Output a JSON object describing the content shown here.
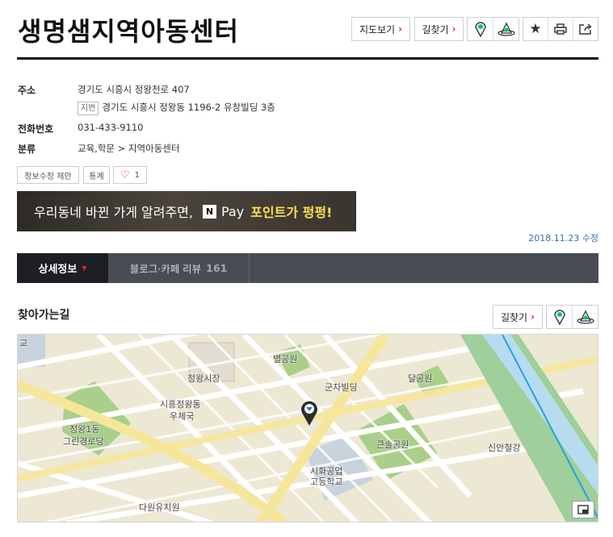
{
  "place": {
    "title": "생명샘지역아동센터",
    "address_label": "주소",
    "address": "경기도 시흥시 정왕천로 407",
    "lot_tag": "지번",
    "lot_address": "경기도 시흥시 정왕동 1196-2 유창빌딩 3층",
    "phone_label": "전화번호",
    "phone": "031-433-9110",
    "category_label": "분류",
    "category": "교육,학문 > 지역아동센터"
  },
  "header_buttons": {
    "map_view": "지도보기",
    "directions": "길찾기"
  },
  "actions": {
    "suggest_edit": "정보수정 제안",
    "stats": "통계",
    "like_count": "1"
  },
  "banner": {
    "text": "우리동네 바뀐 가게 알려주면,",
    "pay_n": "N",
    "pay": "Pay",
    "highlight": "포인트가 펑펑!"
  },
  "updated": "2018.11.23 수정",
  "tabs": {
    "detail": "상세정보",
    "review": "블로그·카페 리뷰",
    "review_count": "161"
  },
  "directions_section": {
    "title": "찾아가는길",
    "directions_button": "길찾기"
  },
  "map_labels": {
    "edge_left": "교",
    "market": "정왕시장",
    "post_office_1": "시흥정왕동",
    "post_office_2": "우체국",
    "star_park": "별공원",
    "gunja": "군자빌딩",
    "moon_park": "달공원",
    "church_1": "정왕1동",
    "church_2": "그린경로당",
    "keunsol": "큰솔공원",
    "school_1": "시화공업",
    "school_2": "고등학교",
    "sinan": "신안철강",
    "kinder": "다원유치원"
  },
  "colors": {
    "accent_red": "#e5252a",
    "tab_dark": "#1e1f24",
    "tab_bar": "#4a4c55",
    "naver_green": "#03c75a",
    "link_blue": "#3a6fb0"
  }
}
